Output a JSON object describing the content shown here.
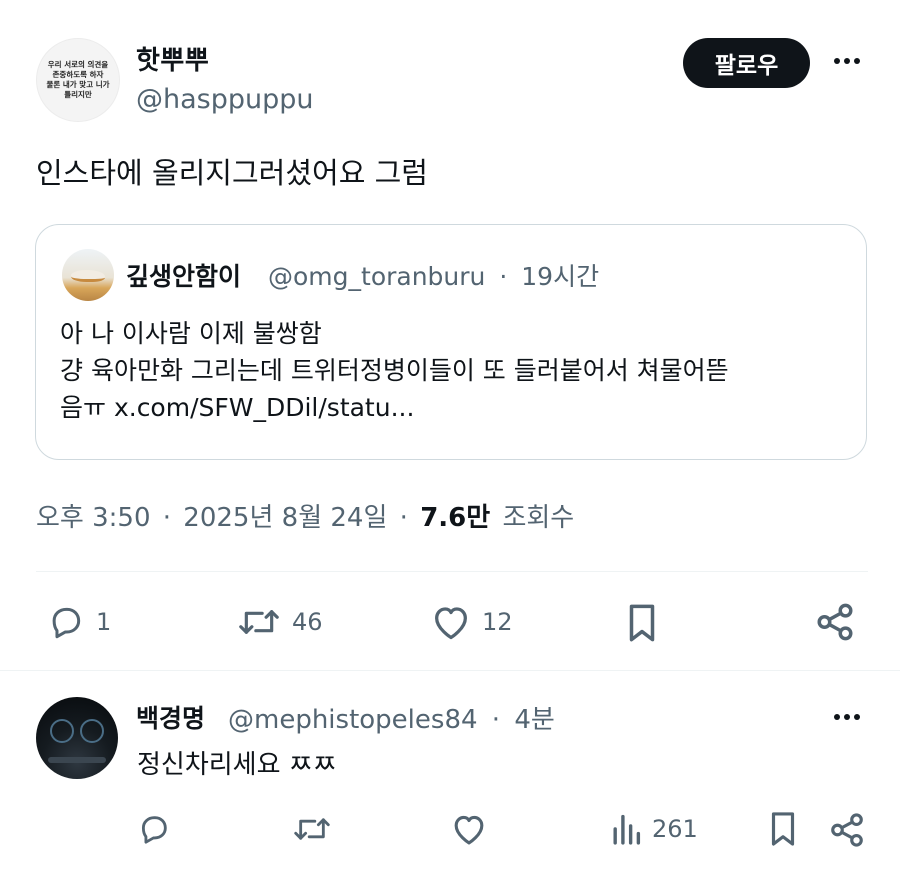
{
  "main_tweet": {
    "avatar_text": [
      "우리 서로의 의견을",
      "존중하도록 하자",
      "물론 내가 맞고 니가",
      "틀리지만"
    ],
    "display_name": "핫뿌뿌",
    "handle": "@hasppuppu",
    "follow_label": "팔로우",
    "text": "인스타에 올리지그러셨어요 그럼",
    "quote": {
      "display_name": "깊생안함이",
      "handle": "@omg_toranburu",
      "separator": "·",
      "time": "19시간",
      "lines": [
        "아 나 이사람 이제 불쌍함",
        "걍 육아만화 그리는데 트위터정병이들이 또 들러붙어서 쳐물어뜯",
        "음ㅠ x.com/SFW_DDil/statu..."
      ]
    },
    "timestamp": {
      "time": "오후 3:50",
      "dot": "·",
      "date": "2025년 8월 24일",
      "views_count": "7.6만",
      "views_label": "조회수"
    },
    "actions": {
      "replies": "1",
      "retweets": "46",
      "likes": "12"
    }
  },
  "reply": {
    "display_name": "백경명",
    "handle": "@mephistopeles84",
    "separator": "·",
    "time": "4분",
    "text": "정신차리세요 ㅉㅉ",
    "actions": {
      "views": "261"
    }
  },
  "colors": {
    "text": "#0f1419",
    "secondary": "#536471",
    "border": "#cfd9de",
    "divider": "#eff3f4",
    "follow_bg": "#0f1419"
  }
}
